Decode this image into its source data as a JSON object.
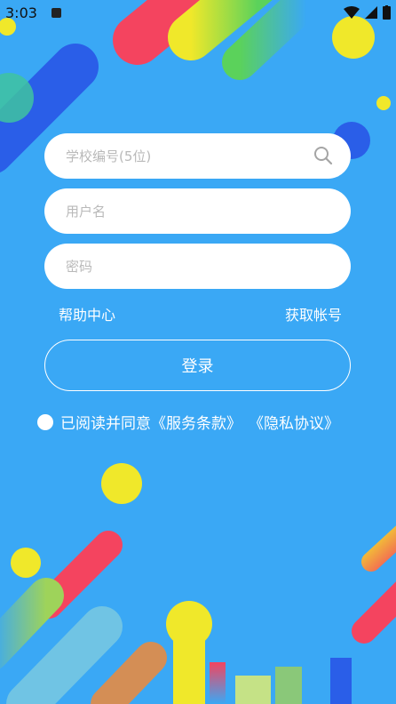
{
  "status_bar": {
    "time": "3:03"
  },
  "form": {
    "school_code_placeholder": "学校编号(5位)",
    "username_placeholder": "用户名",
    "password_placeholder": "密码"
  },
  "links": {
    "help": "帮助中心",
    "get_account": "获取帐号"
  },
  "login_label": "登录",
  "agreement": {
    "text": "已阅读并同意",
    "terms": "《服务条款》",
    "privacy": "《隐私协议》"
  },
  "colors": {
    "background": "#3aa8f5",
    "accent_red": "#f4445f",
    "accent_yellow": "#f1e324",
    "accent_blue": "#2a5ee8"
  }
}
